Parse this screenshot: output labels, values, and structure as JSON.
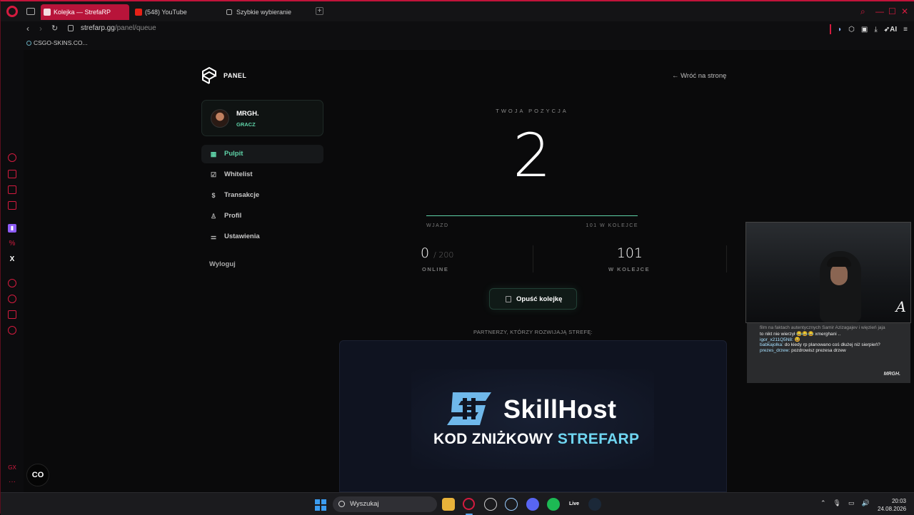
{
  "browser": {
    "tabs": [
      {
        "label": "Kolejka — StrefaRP",
        "active": true
      },
      {
        "label": "(548) YouTube",
        "active": false
      },
      {
        "label": "Szybkie wybieranie",
        "active": false
      }
    ],
    "url_host": "strefarp.gg",
    "url_path": "/panel/queue",
    "bookmarks": [
      "CSGO-SKINS.CO..."
    ],
    "ai_label": "AI"
  },
  "sidebar_bottom": {
    "cc_label": "CO"
  },
  "panel": {
    "title": "PANEL",
    "back_link": "← Wróć na stronę",
    "user": {
      "name": "MRGH.",
      "role": "GRACZ"
    },
    "menu": [
      {
        "label": "Pulpit",
        "icon": "dashboard-icon",
        "active": true
      },
      {
        "label": "Whitelist",
        "icon": "checkbox-icon",
        "active": false
      },
      {
        "label": "Transakcje",
        "icon": "dollar-icon",
        "active": false
      },
      {
        "label": "Profil",
        "icon": "user-icon",
        "active": false
      },
      {
        "label": "Ustawienia",
        "icon": "sliders-icon",
        "active": false
      }
    ],
    "logout": "Wyloguj"
  },
  "queue": {
    "position_label": "TWOJA POZYCJA",
    "position": "2",
    "progress_fraction": 1.0,
    "progress_left": "WJAZD",
    "progress_right": "101 W KOLEJCE",
    "online_value": "0",
    "online_max": "/ 200",
    "online_label": "ONLINE",
    "queue_value": "101",
    "queue_label": "W KOLEJCE",
    "leave_button": "Opuść kolejkę",
    "partners_label": "PARTNERZY, KTÓRZY ROZWIJAJĄ STREFĘ:"
  },
  "banner": {
    "brand": "SkillHost",
    "code_prefix": "KOD ZNIŻKOWY",
    "code": "STREFARP"
  },
  "stream": {
    "signature": "A",
    "badge": "MRGH.",
    "chat": [
      {
        "nick": "",
        "text": "film na faktach autentycznych Samir Azizagajev i więzień jaja",
        "faded": true
      },
      {
        "nick": "",
        "text": "to nikt nie wierzył 😂😂😂 xmerghani ..",
        "faded": false
      },
      {
        "nick": "igor_x211Q5N8:",
        "text": "😆",
        "faded": false
      },
      {
        "nick": "babkajolka:",
        "text": "do kiedy rp planowano coś dłużej niż sierpień?",
        "faded": false
      },
      {
        "nick": "prezes_drzew:",
        "text": "pozdrowisz prezesa drzew",
        "faded": false
      }
    ]
  },
  "taskbar": {
    "search_placeholder": "Wyszukaj",
    "live_label": "Live",
    "time": "20:03",
    "date": "24.08.2026"
  },
  "colors": {
    "accent": "#5fd3a8",
    "brand_red": "#d41b3f",
    "banner_accent": "#6fd5f0"
  }
}
